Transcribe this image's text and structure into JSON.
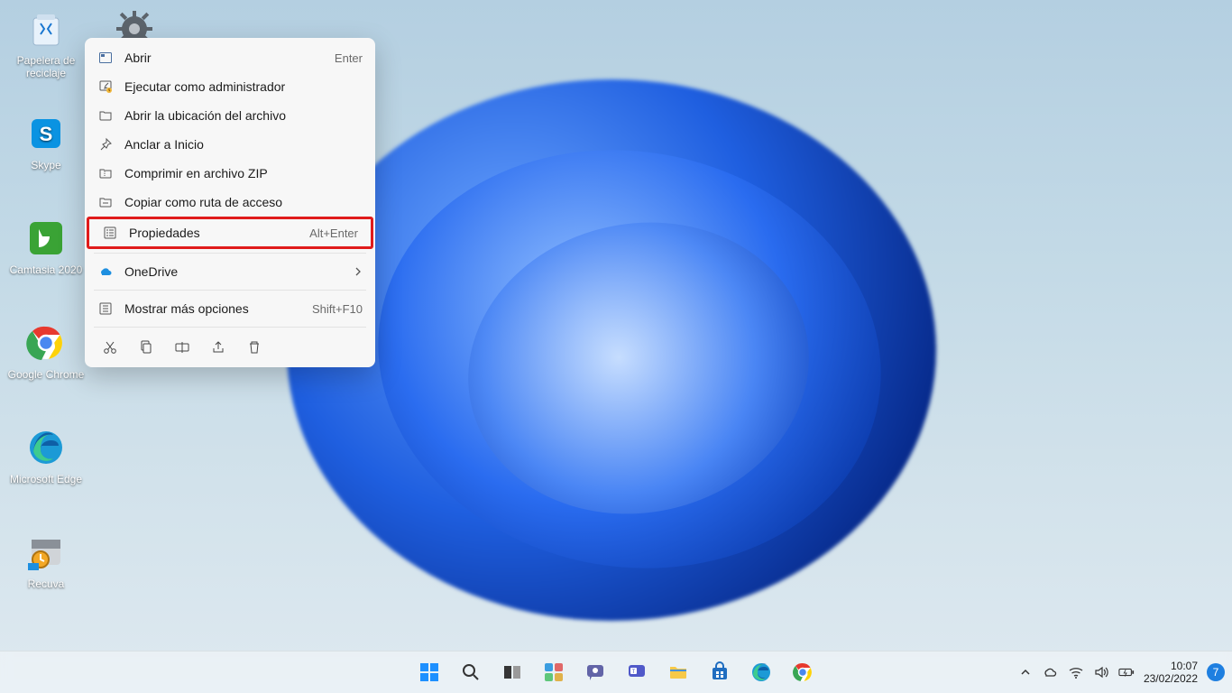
{
  "desktop_icons": [
    {
      "id": "recycle-bin",
      "label": "Papelera de reciclaje"
    },
    {
      "id": "settings",
      "label": ""
    },
    {
      "id": "skype",
      "label": "Skype"
    },
    {
      "id": "camtasia",
      "label": "Camtasia 2020"
    },
    {
      "id": "chrome",
      "label": "Google Chrome"
    },
    {
      "id": "edge",
      "label": "Microsoft Edge"
    },
    {
      "id": "recuva",
      "label": "Recuva"
    }
  ],
  "context_menu": {
    "items": [
      {
        "icon": "open-icon",
        "label": "Abrir",
        "hint": "Enter"
      },
      {
        "icon": "admin-icon",
        "label": "Ejecutar como administrador",
        "hint": ""
      },
      {
        "icon": "folder-open-icon",
        "label": "Abrir la ubicación del archivo",
        "hint": ""
      },
      {
        "icon": "pin-icon",
        "label": "Anclar a Inicio",
        "hint": ""
      },
      {
        "icon": "zip-icon",
        "label": "Comprimir en archivo ZIP",
        "hint": ""
      },
      {
        "icon": "copy-path-icon",
        "label": "Copiar como ruta de acceso",
        "hint": ""
      },
      {
        "icon": "properties-icon",
        "label": "Propiedades",
        "hint": "Alt+Enter",
        "highlighted": true
      },
      {
        "icon": "onedrive-icon",
        "label": "OneDrive",
        "hint": "",
        "submenu": true
      },
      {
        "icon": "more-icon",
        "label": "Mostrar más opciones",
        "hint": "Shift+F10"
      }
    ],
    "bottom_icons": [
      "cut-icon",
      "copy-icon",
      "rename-icon",
      "share-icon",
      "delete-icon"
    ]
  },
  "taskbar": {
    "center": [
      "start",
      "search",
      "task-view",
      "widgets",
      "chat",
      "teams",
      "explorer",
      "store",
      "edge",
      "chrome"
    ],
    "tray_icons": [
      "chevron-up-icon",
      "onedrive-tray-icon",
      "wifi-icon",
      "volume-icon",
      "battery-icon"
    ],
    "clock": {
      "time": "10:07",
      "date": "23/02/2022"
    },
    "badge": "7"
  },
  "colors": {
    "accent": "#1e7fe0",
    "highlight": "#e01b1b"
  }
}
